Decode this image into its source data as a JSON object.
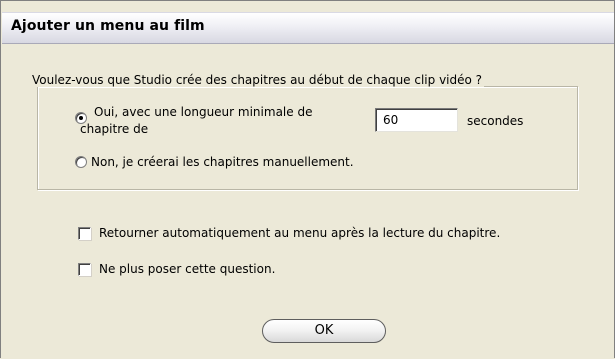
{
  "window": {
    "title": "Ajouter un menu au film"
  },
  "chapters_group": {
    "legend": "Voulez-vous que Studio crée des chapitres au début de chaque clip vidéo ?",
    "option_auto": {
      "line1": "Oui, avec une longueur minimale de",
      "line2": "chapitre de",
      "selected": true
    },
    "min_length_value": "60",
    "unit_label": "secondes",
    "option_manual": {
      "label": "Non, je créerai les chapitres manuellement.",
      "selected": false
    }
  },
  "options": {
    "return_to_menu": {
      "label": "Retourner automatiquement au menu après la lecture du chapitre.",
      "checked": false
    },
    "dont_ask_again": {
      "label": "Ne plus poser cette question.",
      "checked": false
    }
  },
  "buttons": {
    "ok_label": "OK"
  }
}
